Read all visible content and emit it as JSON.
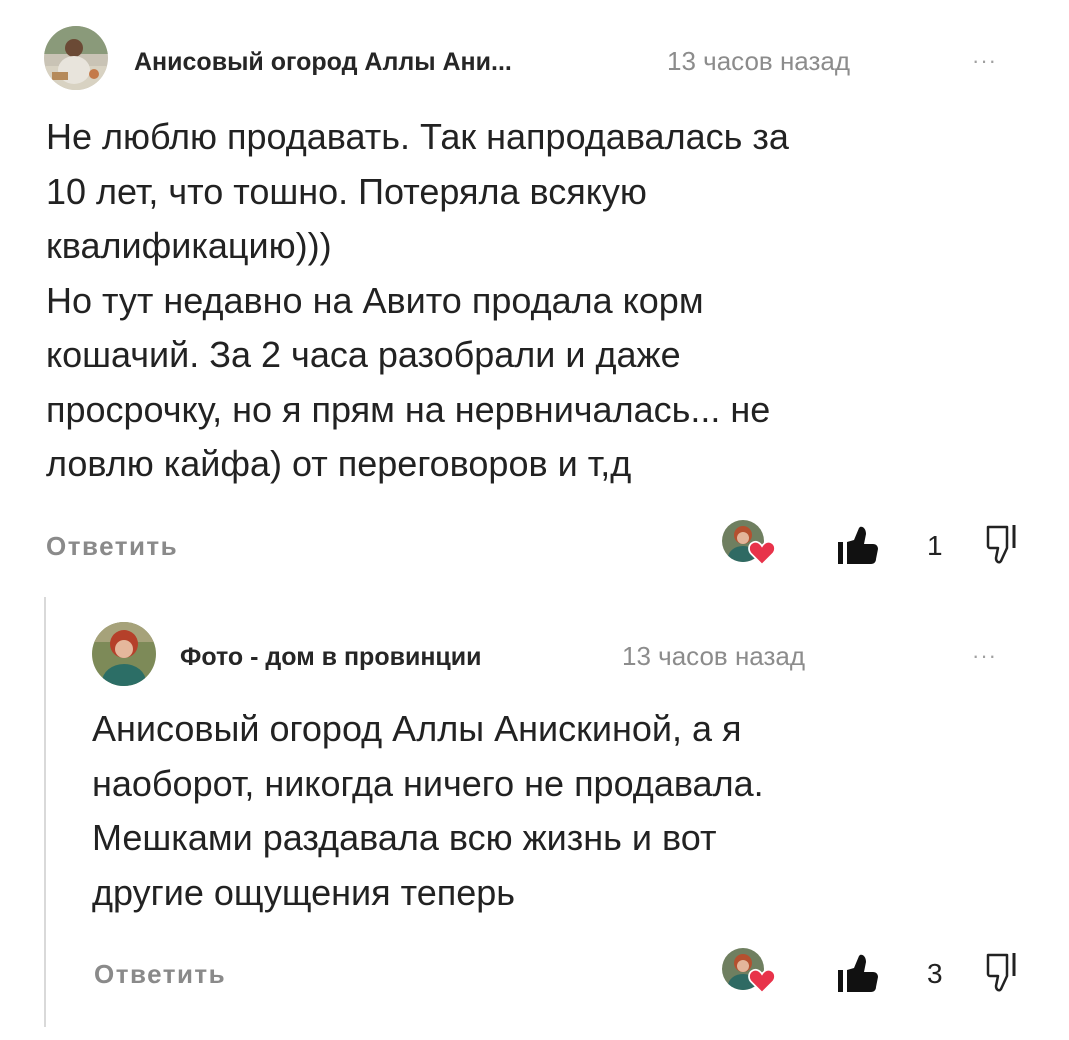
{
  "comment1": {
    "author": "Анисовый огород Аллы Ани...",
    "time": "13 часов назад",
    "more": "···",
    "lines": [
      "Не люблю продавать. Так напродавалась за",
      "10 лет, что тошно. Потеряла всякую",
      "квалификацию)))",
      "Но тут недавно на Авито продала корм",
      "кошачий. За 2 часа разобрали и даже",
      "просрочку, но я прям на нервничалась... не",
      "ловлю кайфа) от переговоров и т,д"
    ],
    "reply_label": "Ответить",
    "like_count": "1"
  },
  "comment2": {
    "author": "Фото - дом в провинции",
    "time": "13 часов назад",
    "more": "···",
    "lines": [
      "Анисовый огород Аллы Анискиной, а я",
      "наоборот, никогда ничего не продавала.",
      "Мешками раздавала всю жизнь и вот",
      "другие ощущения теперь"
    ],
    "reply_label": "Ответить",
    "like_count": "3"
  },
  "icons": {
    "avatar": "avatar-photo",
    "author_heart": "author-heart-icon",
    "like": "thumbs-up-icon",
    "dislike": "thumbs-down-icon",
    "heart_color": "#e8334a"
  }
}
